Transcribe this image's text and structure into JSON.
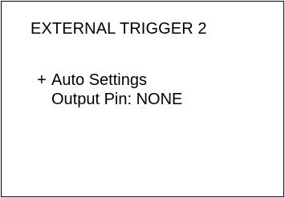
{
  "screen": {
    "title": "EXTERNAL TRIGGER 2",
    "menu": {
      "items": [
        {
          "marker": "+",
          "label": "Auto Settings"
        },
        {
          "label": "Output Pin: NONE"
        }
      ]
    }
  }
}
